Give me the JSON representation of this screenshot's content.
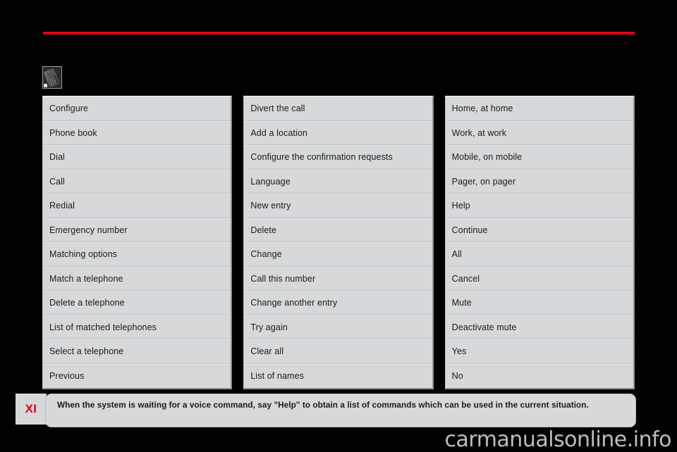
{
  "page": {
    "background_color": "#000000",
    "accent_color": "#e2001a",
    "panel_color": "#d6d8da",
    "chapter_marker": "XI",
    "watermark": "carmanualsonline.info"
  },
  "section_icon": {
    "name": "telephone-icon",
    "description": "grayscale mobile telephone handset thumbnail"
  },
  "tables": [
    {
      "id": "column-1",
      "rows": [
        "Configure",
        "Phone book",
        "Dial",
        "Call",
        "Redial",
        "Emergency number",
        "Matching options",
        "Match a telephone",
        "Delete a telephone",
        "List of matched telephones",
        "Select a telephone",
        "Previous"
      ]
    },
    {
      "id": "column-2",
      "rows": [
        "Divert the call",
        "Add a location",
        "Configure the confirmation requests",
        "Language",
        "New entry",
        "Delete",
        "Change",
        "Call this number",
        "Change another entry",
        "Try again",
        "Clear all",
        "List of names"
      ]
    },
    {
      "id": "column-3",
      "rows": [
        "Home, at home",
        "Work, at work",
        "Mobile, on mobile",
        "Pager, on pager",
        "Help",
        "Continue",
        "All",
        "Cancel",
        "Mute",
        "Deactivate mute",
        "Yes",
        "No"
      ]
    }
  ],
  "note": {
    "marker": "XI",
    "text": "When the system is waiting for a voice command, say \"Help\" to obtain a list of commands which can be used in the current situation."
  }
}
